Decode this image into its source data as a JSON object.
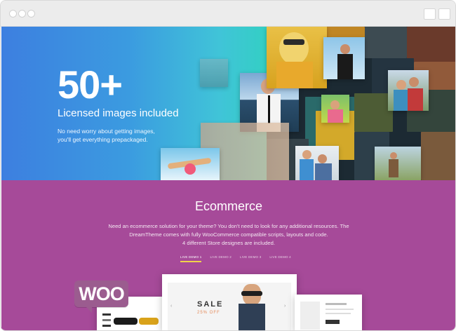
{
  "window": {
    "controls": [
      "dot-1",
      "dot-2",
      "dot-3"
    ]
  },
  "hero": {
    "big_number": "50+",
    "subtitle": "Licensed images included",
    "description_line1": "No need worry about getting images,",
    "description_line2": "you'll get everything prepackaged."
  },
  "ecommerce": {
    "title": "Ecommerce",
    "text_line1": "Need an ecommerce solution for your theme? You don't need to look for any additional resources. The",
    "text_line2": "DreamTheme comes with fully WooCommerce compatible scripts, layouts and code.",
    "text_line3": "4 different Store designes are included.",
    "tabs": [
      "Live Demo 1",
      "Live Demo 2",
      "Live Demo 3",
      "Live Demo 4"
    ],
    "woo_label": "WOO",
    "sale_title": "SALE",
    "sale_subtitle": "25% OFF"
  }
}
